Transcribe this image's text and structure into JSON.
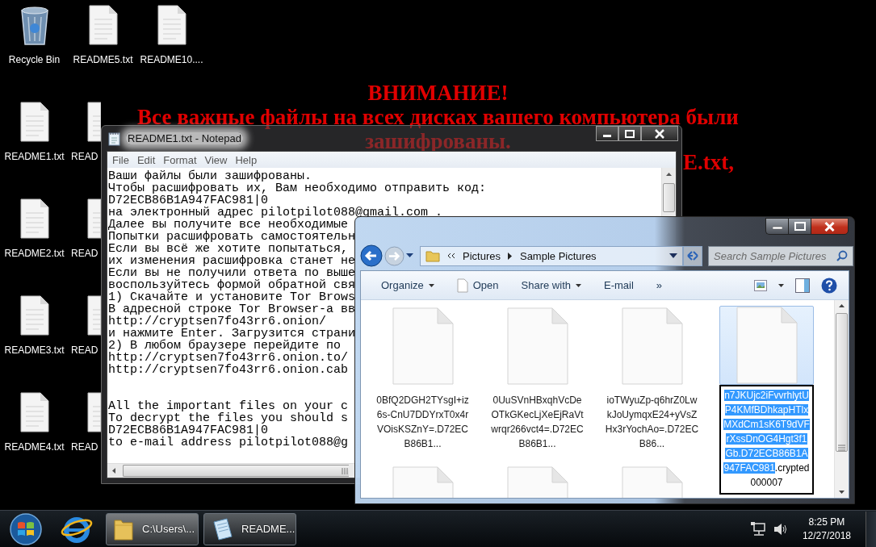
{
  "desktop": {
    "banner": {
      "heading": "ВНИМАНИЕ!",
      "lines": [
        "Все важные файлы на всех дисках вашего компьютера были",
        "зашифрованы."
      ],
      "fragment": "E.txt,"
    },
    "icons": [
      {
        "label": "Recycle Bin",
        "kind": "recycle_bin"
      },
      {
        "label": "README1.txt",
        "kind": "file"
      },
      {
        "label": "README2.txt",
        "kind": "file"
      },
      {
        "label": "README3.txt",
        "kind": "file"
      },
      {
        "label": "README4.txt",
        "kind": "file"
      },
      {
        "label": "README5.txt",
        "kind": "file"
      },
      {
        "label": "READ",
        "kind": "file_partial"
      },
      {
        "label": "READ",
        "kind": "file_partial"
      },
      {
        "label": "READ",
        "kind": "file_partial"
      },
      {
        "label": "READ",
        "kind": "file_partial"
      },
      {
        "label": "README10....",
        "kind": "file"
      }
    ]
  },
  "notepad": {
    "title": "README1.txt - Notepad",
    "menu": [
      "File",
      "Edit",
      "Format",
      "View",
      "Help"
    ],
    "paragraphs": [
      [
        "Ваши файлы были зашифрованы.",
        "Чтобы расшифровать их, Вам необходимо отправить код:",
        "D72ECB86B1A947FAC981|0",
        "на электронный адрес pilotpilot088@gmail.com .",
        "Далее вы получите все необходимые",
        "Попытки расшифровать самостоятельн",
        "Если вы всё же хотите попытаться,",
        "их изменения расшифровка станет не",
        "Если вы не получили ответа по выше",
        "воспользуйтесь формой обратной свя",
        "1) Скачайте и установите Tor Brows",
        "В адресной строке Tor Browser-а вв",
        "http://cryptsen7fo43rr6.onion/",
        "и нажмите Enter. Загрузится страни",
        "2) В любом браузере перейдите по",
        "http://cryptsen7fo43rr6.onion.to/",
        "http://cryptsen7fo43rr6.onion.cab"
      ],
      [
        "All the important files on your c",
        "To decrypt the files you should s",
        "D72ECB86B1A947FAC981|0",
        "to e-mail address pilotpilot088@g"
      ]
    ]
  },
  "explorer": {
    "breadcrumb": [
      "Pictures",
      "Sample Pictures"
    ],
    "search": {
      "placeholder": "Search Sample Pictures"
    },
    "commands": [
      {
        "label": "Organize",
        "kind": "menu"
      },
      {
        "label": "Open",
        "kind": "with_icon"
      },
      {
        "label": "Share with",
        "kind": "menu"
      },
      {
        "label": "E-mail",
        "kind": "plain"
      },
      {
        "label": "»",
        "kind": "plain"
      }
    ],
    "files": [
      {
        "kind": "file",
        "selected": false,
        "name": "0BfQ2DGH2TYsgI+iz6s-CnU7DDYrxT0x4rVOisKSZnY=.D72ECB86B1..."
      },
      {
        "kind": "file",
        "selected": false,
        "name": "0UuSVnHBxqhVcDeOTkGKecLjXeEjRaVtwrqr266vct4=.D72ECB86B1..."
      },
      {
        "kind": "file",
        "selected": false,
        "name": "ioTWyuZp-q6hrZ0LwkJoUymqxE24+yVsZHx3rYochAo=.D72ECB86..."
      },
      {
        "kind": "renaming",
        "selected": true,
        "name_selected": "n7JKUjc2iFvvrhlytUP4KMfBDhkapHTlxMXdCm1sK6T9dVFrXssDnOG4Hgt3f1Gb.D72ECB86B1A947FAC981",
        "name_rest": ".crypted000007"
      },
      {
        "kind": "file",
        "selected": false
      },
      {
        "kind": "file",
        "selected": false
      },
      {
        "kind": "file",
        "selected": false
      }
    ]
  },
  "taskbar": {
    "tasks": [
      {
        "label": "C:\\Users\\...",
        "kind": "folder"
      },
      {
        "label": "README...",
        "kind": "notepad"
      }
    ],
    "time": "8:25 PM",
    "date": "12/27/2018"
  }
}
